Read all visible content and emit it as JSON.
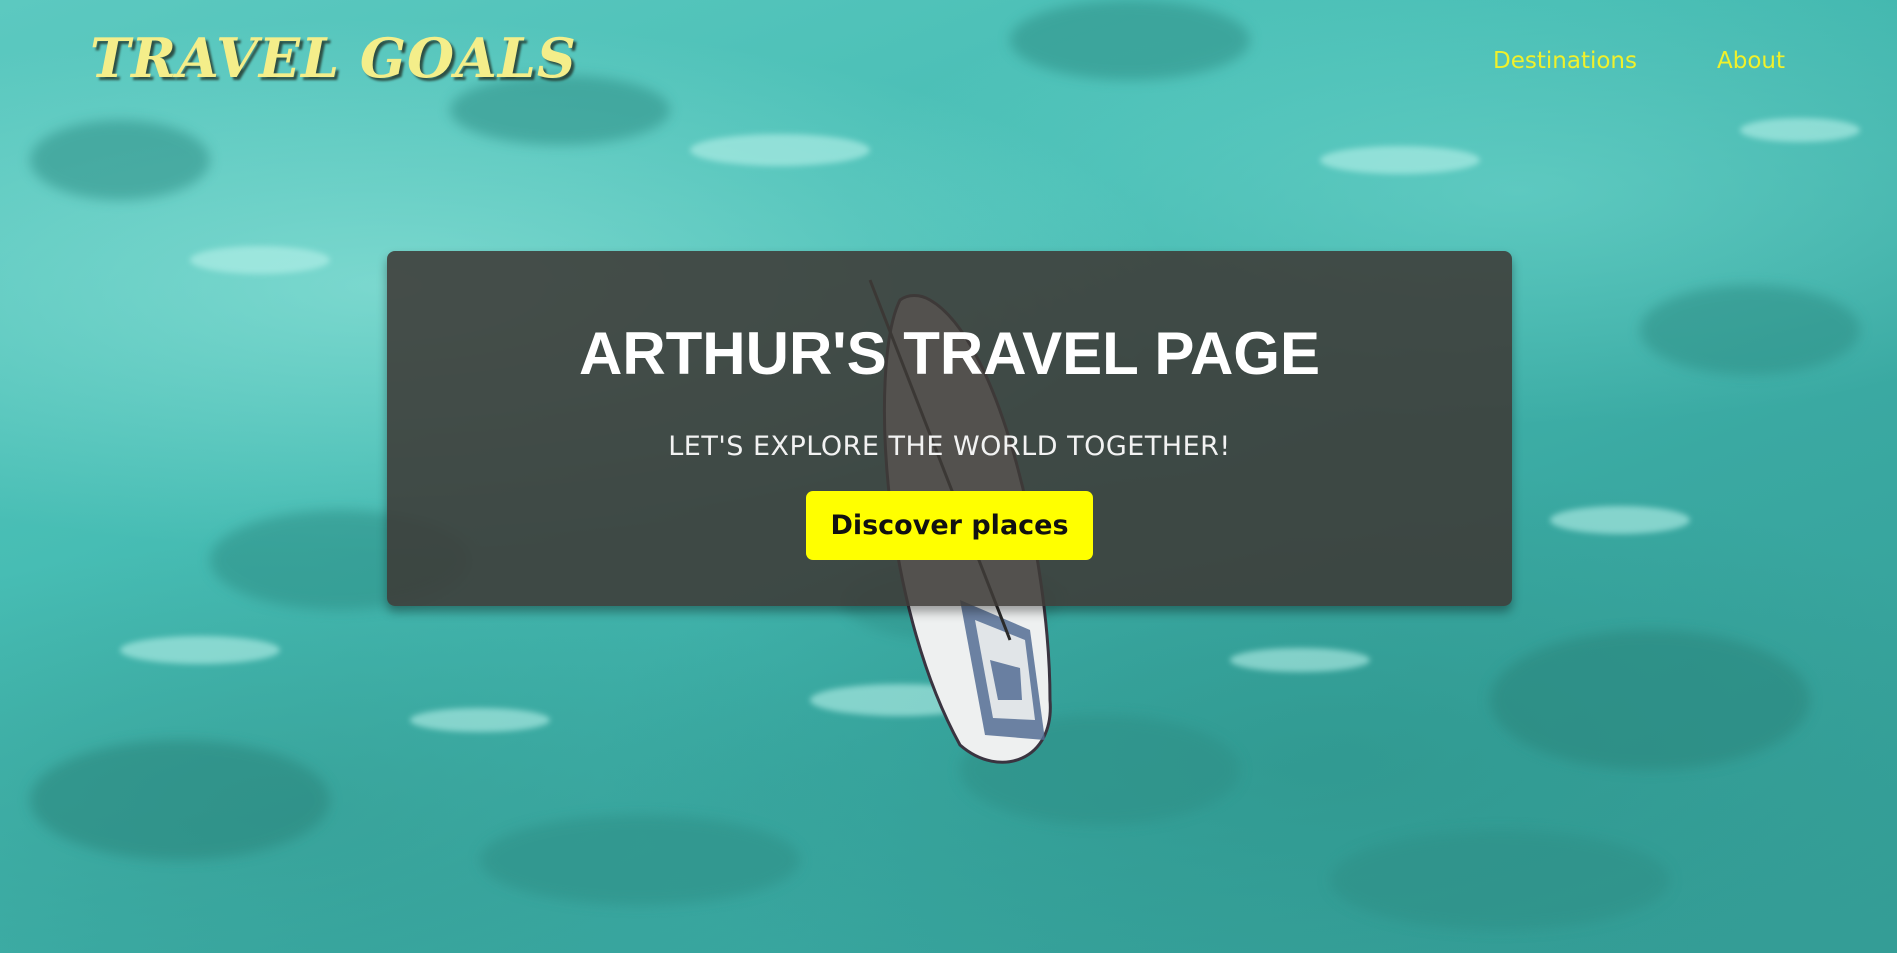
{
  "header": {
    "logo_text": "TRAVEL GOALS",
    "nav": [
      {
        "label": "Destinations"
      },
      {
        "label": "About"
      }
    ]
  },
  "hero": {
    "title": "ARTHUR'S TRAVEL PAGE",
    "tagline": "LET'S EXPLORE THE WORLD TOGETHER!",
    "cta_label": "Discover places",
    "background": "aerial-turquoise-sea-with-paddleboard"
  },
  "colors": {
    "logo": "#f4ee8a",
    "nav_link": "#f1f12a",
    "cta_background": "#ffff00",
    "panel": "#3e3a37",
    "sea": "#47bdb4"
  }
}
